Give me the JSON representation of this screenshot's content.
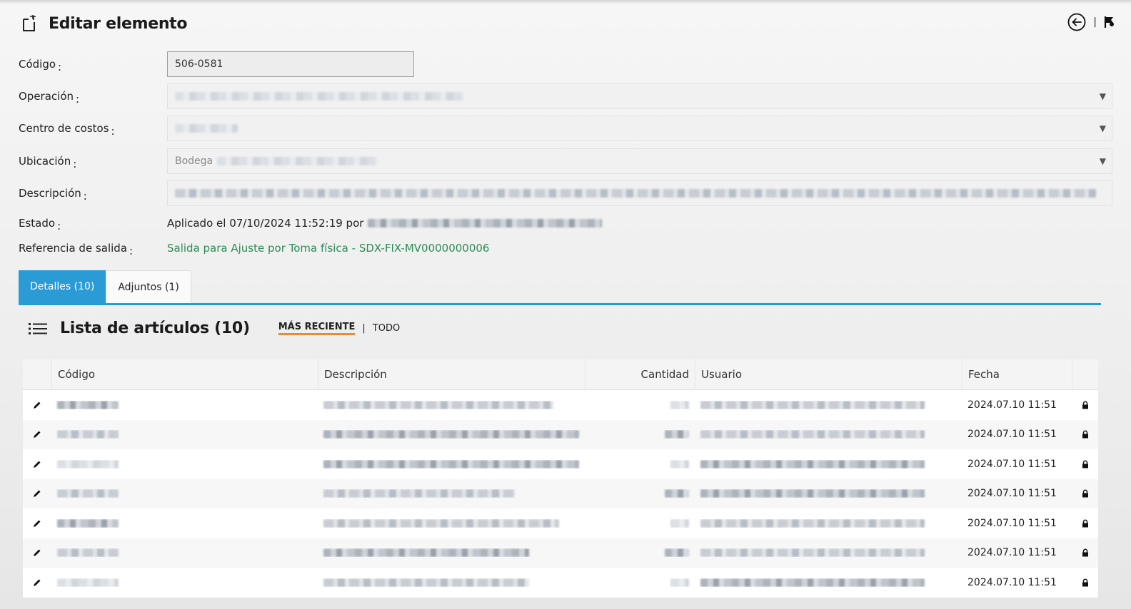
{
  "header": {
    "title": "Editar elemento",
    "title_icon": "edit-document-icon",
    "back_icon": "back-arrow-circle-icon",
    "separator": "|",
    "flag_icon": "flag-icon"
  },
  "form": {
    "codigo": {
      "label": "Código",
      "value": "506-0581"
    },
    "operacion": {
      "label": "Operación"
    },
    "centro_costos": {
      "label": "Centro de costos"
    },
    "ubicacion": {
      "label": "Ubicación",
      "value_prefix": "Bodega"
    },
    "descripcion": {
      "label": "Descripción"
    },
    "estado": {
      "label": "Estado",
      "value": "Aplicado el 07/10/2024 11:52:19 por"
    },
    "referencia": {
      "label": "Referencia de salida",
      "value": "Salida para Ajuste por Toma física - SDX-FIX-MV0000000006"
    },
    "colon": ":"
  },
  "tabs": [
    {
      "label": "Detalles (10)",
      "active": true
    },
    {
      "label": "Adjuntos (1)",
      "active": false
    }
  ],
  "list": {
    "title": "Lista de artículos (10)",
    "icon": "list-icon",
    "filters": {
      "recent": "MÁS RECIENTE",
      "all": "TODO",
      "separator": "|"
    },
    "columns": [
      "Código",
      "Descripción",
      "Cantidad",
      "Usuario",
      "Fecha"
    ],
    "rows": [
      {
        "fecha": "2024.07.10 11:51"
      },
      {
        "fecha": "2024.07.10 11:51"
      },
      {
        "fecha": "2024.07.10 11:51"
      },
      {
        "fecha": "2024.07.10 11:51"
      },
      {
        "fecha": "2024.07.10 11:51"
      },
      {
        "fecha": "2024.07.10 11:51"
      },
      {
        "fecha": "2024.07.10 11:51"
      }
    ]
  },
  "colors": {
    "accent": "#2b9bd6",
    "link": "#2e8b57",
    "filter_underline": "#f08a24"
  }
}
